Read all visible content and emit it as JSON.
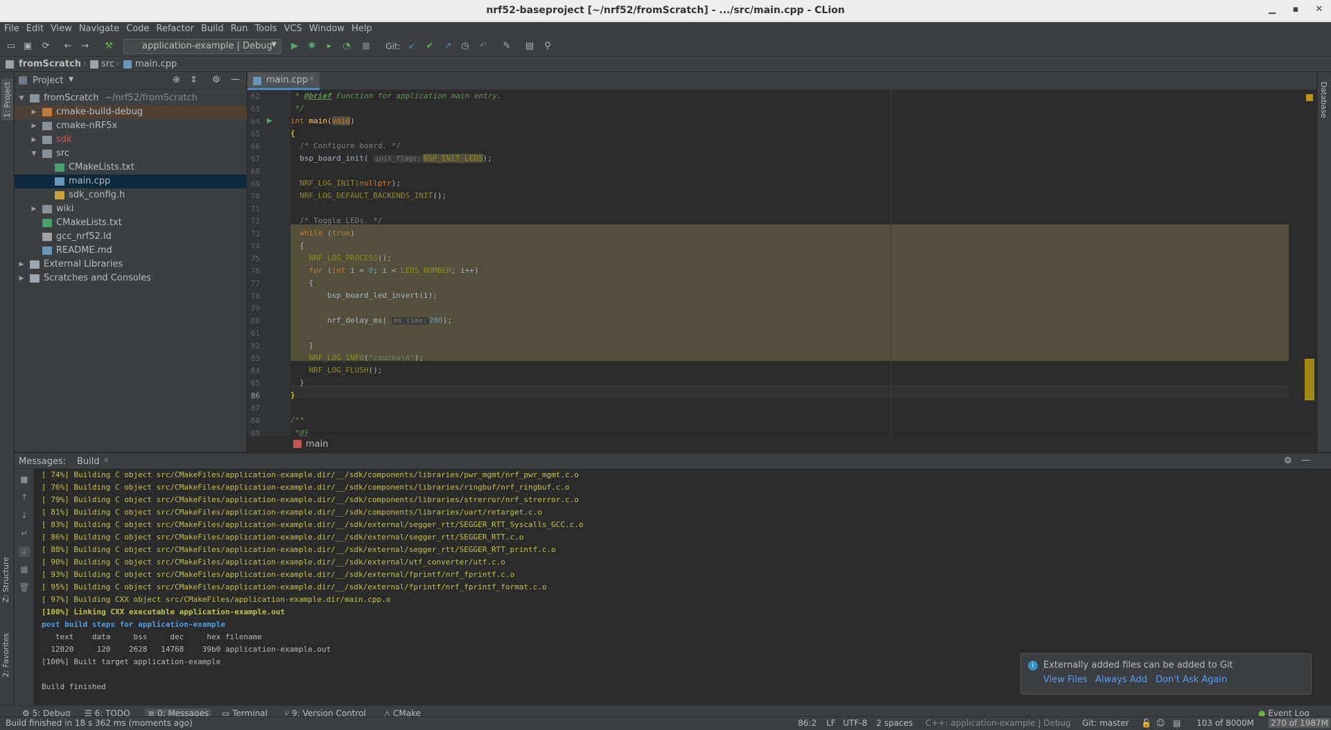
{
  "window": {
    "title": "nrf52-baseproject [~/nrf52/fromScratch] - .../src/main.cpp - CLion"
  },
  "menu": [
    "File",
    "Edit",
    "View",
    "Navigate",
    "Code",
    "Refactor",
    "Build",
    "Run",
    "Tools",
    "VCS",
    "Window",
    "Help"
  ],
  "toolbar": {
    "run_config": "application-example | Debug",
    "git_label": "Git:"
  },
  "navbar": {
    "root": "fromScratch",
    "dir": "src",
    "file": "main.cpp"
  },
  "side_tabs": {
    "project": "1: Project",
    "structure": "Z: Structure",
    "favorites": "2: Favorites",
    "database": "Database"
  },
  "project": {
    "title": "Project",
    "tree": [
      {
        "label": "fromScratch",
        "suffix": "~/nrf52/fromScratch",
        "depth": 0,
        "expanded": true,
        "icon": "folder"
      },
      {
        "label": "cmake-build-debug",
        "depth": 1,
        "expanded": false,
        "icon": "folder-excluded"
      },
      {
        "label": "cmake-nRF5x",
        "depth": 1,
        "expanded": false,
        "icon": "folder"
      },
      {
        "label": "sdk",
        "depth": 1,
        "expanded": false,
        "icon": "folder-red"
      },
      {
        "label": "src",
        "depth": 1,
        "expanded": true,
        "icon": "folder"
      },
      {
        "label": "CMakeLists.txt",
        "depth": 2,
        "icon": "cmake-file"
      },
      {
        "label": "main.cpp",
        "depth": 2,
        "icon": "cpp-file",
        "selected": true
      },
      {
        "label": "sdk_config.h",
        "depth": 2,
        "icon": "header-file"
      },
      {
        "label": "wiki",
        "depth": 1,
        "expanded": false,
        "icon": "folder"
      },
      {
        "label": "CMakeLists.txt",
        "depth": 1,
        "icon": "cmake-file"
      },
      {
        "label": "gcc_nrf52.ld",
        "depth": 1,
        "icon": "text-file"
      },
      {
        "label": "README.md",
        "depth": 1,
        "icon": "md-file"
      },
      {
        "label": "External Libraries",
        "depth": 0,
        "expanded": false,
        "icon": "library"
      },
      {
        "label": "Scratches and Consoles",
        "depth": 0,
        "expanded": false,
        "icon": "scratch"
      }
    ]
  },
  "editor": {
    "tab": "main.cpp",
    "breadcrumb": "main",
    "lines": [
      "62",
      "63",
      "64",
      "65",
      "66",
      "67",
      "68",
      "69",
      "70",
      "71",
      "72",
      "73",
      "74",
      "75",
      "76",
      "77",
      "78",
      "79",
      "80",
      "81",
      "82",
      "83",
      "84",
      "85",
      "86",
      "87",
      "88",
      "89"
    ],
    "code": {
      "l62_doc": " * ",
      "l62_tag": "@brief",
      "l62_rest": " Function for application main entry.",
      "l63": " */",
      "l64_kw": "int",
      "l64_fn": " main(",
      "l64_void": "void",
      "l64_end": ")",
      "l65": "{",
      "l66": "  /* Configure board. */",
      "l67_a": "  bsp_board_init( ",
      "l67_hint": "init_flags:",
      "l67_mac": "BSP_INIT_LEDS",
      "l67_end": ");",
      "l69_mac": "  NRF_LOG_INIT(",
      "l69_kw": "nullptr",
      "l69_end": ");",
      "l70_mac": "  NRF_LOG_DEFAULT_BACKENDS_INIT",
      "l70_end": "();",
      "l72": "  /* Toggle LEDs. */",
      "l73_kw": "  while",
      "l73_a": " (",
      "l73_kw2": "true",
      "l73_end": ")",
      "l74": "  {",
      "l75_mac": "    NRF_LOG_PROCESS",
      "l75_end": "();",
      "l76_kw": "    for",
      "l76_a": " (",
      "l76_kw2": "int",
      "l76_b": " i = ",
      "l76_num": "0",
      "l76_c": "; i < ",
      "l76_mac": "LEDS_NUMBER",
      "l76_d": "; i++)",
      "l77": "    {",
      "l78": "        bsp_board_led_invert(i);",
      "l80_a": "        nrf_delay_ms( ",
      "l80_hint": "ms_time:",
      "l80_num": "200",
      "l80_end": ");",
      "l82": "    }",
      "l83_mac": "    NRF_LOG_INFO",
      "l83_a": "(",
      "l83_str": "\"coucou\\n\"",
      "l83_end": ");",
      "l84_mac": "    NRF_LOG_FLUSH",
      "l84_end": "();",
      "l85": "  }",
      "l86": "}",
      "l88": "/**",
      "l89": " *@}"
    }
  },
  "messages": {
    "title": "Messages:",
    "tab": "Build",
    "output": [
      {
        "text": "[ 74%] Building C object src/CMakeFiles/application-example.dir/__/sdk/components/libraries/pwr_mgmt/nrf_pwr_mgmt.c.o",
        "style": "y"
      },
      {
        "text": "[ 76%] Building C object src/CMakeFiles/application-example.dir/__/sdk/components/libraries/ringbuf/nrf_ringbuf.c.o",
        "style": "y"
      },
      {
        "text": "[ 79%] Building C object src/CMakeFiles/application-example.dir/__/sdk/components/libraries/strerror/nrf_strerror.c.o",
        "style": "y"
      },
      {
        "text": "[ 81%] Building C object src/CMakeFiles/application-example.dir/__/sdk/components/libraries/uart/retarget.c.o",
        "style": "y"
      },
      {
        "text": "[ 83%] Building C object src/CMakeFiles/application-example.dir/__/sdk/external/segger_rtt/SEGGER_RTT_Syscalls_GCC.c.o",
        "style": "y"
      },
      {
        "text": "[ 86%] Building C object src/CMakeFiles/application-example.dir/__/sdk/external/segger_rtt/SEGGER_RTT.c.o",
        "style": "y"
      },
      {
        "text": "[ 88%] Building C object src/CMakeFiles/application-example.dir/__/sdk/external/segger_rtt/SEGGER_RTT_printf.c.o",
        "style": "y"
      },
      {
        "text": "[ 90%] Building C object src/CMakeFiles/application-example.dir/__/sdk/external/utf_converter/utf.c.o",
        "style": "y"
      },
      {
        "text": "[ 93%] Building C object src/CMakeFiles/application-example.dir/__/sdk/external/fprintf/nrf_fprintf.c.o",
        "style": "y"
      },
      {
        "text": "[ 95%] Building C object src/CMakeFiles/application-example.dir/__/sdk/external/fprintf/nrf_fprintf_format.c.o",
        "style": "y"
      },
      {
        "text": "[ 97%] Building CXX object src/CMakeFiles/application-example.dir/main.cpp.o",
        "style": "y"
      },
      {
        "text": "[100%] Linking CXX executable application-example.out",
        "style": "g"
      },
      {
        "text": "post build steps for application-example",
        "style": "b"
      },
      {
        "text": "   text    data     bss     dec     hex filename",
        "style": "w"
      },
      {
        "text": "  12020     120    2628   14768    39b0 application-example.out",
        "style": "w"
      },
      {
        "text": "[100%] Built target application-example",
        "style": "w"
      },
      {
        "text": "",
        "style": "w"
      },
      {
        "text": "Build finished",
        "style": "w"
      }
    ]
  },
  "notification": {
    "message": "Externally added files can be added to Git",
    "actions": [
      "View Files",
      "Always Add",
      "Don't Ask Again"
    ]
  },
  "tool_windows": [
    {
      "key": "5",
      "label": ": Debug"
    },
    {
      "key": "6",
      "label": ": TODO"
    },
    {
      "key": "0",
      "label": ": Messages"
    },
    {
      "key": "",
      "label": "Terminal"
    },
    {
      "key": "9",
      "label": ": Version Control"
    },
    {
      "key": "",
      "label": "CMake"
    }
  ],
  "event_log": "Event Log",
  "status": {
    "message": "Build finished in 18 s 362 ms (moments ago)",
    "position": "86:2",
    "line_sep": "LF",
    "encoding": "UTF-8",
    "indent": "2 spaces",
    "context": "C++: application-example | Debug",
    "git": "Git: master",
    "flash": "103 of 8000M",
    "memory": "270 of 1987M"
  },
  "colors": {
    "accent": "#4a88c7",
    "selection": "#0d293e",
    "highlight": "#52503a"
  }
}
